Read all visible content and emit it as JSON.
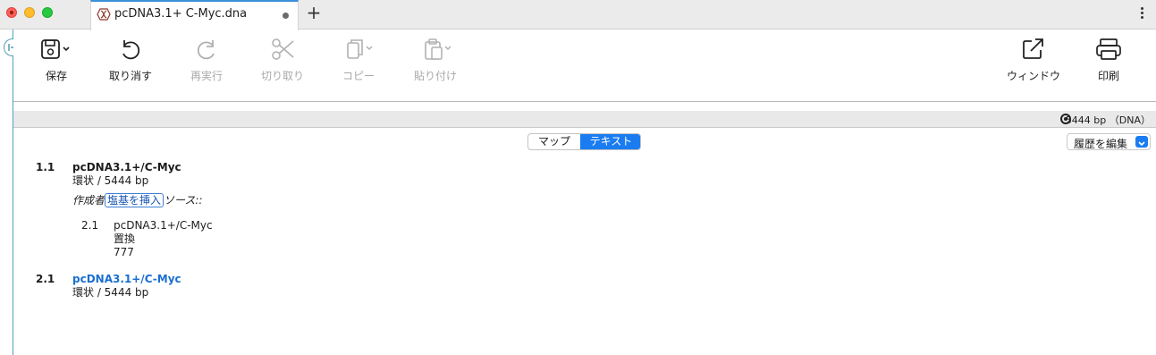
{
  "window": {
    "tab_title": "pcDNA3.1+ C-Myc.dna",
    "new_tab_glyph": "+"
  },
  "toolbar": {
    "save_label": "保存",
    "undo_label": "取り消す",
    "redo_label": "再実行",
    "cut_label": "切り取り",
    "copy_label": "コピー",
    "paste_label": "貼り付け",
    "window_label": "ウィンドウ",
    "print_label": "印刷"
  },
  "status": {
    "size_text": "5444 bp （DNA）"
  },
  "view_switch": {
    "map_label": "マップ",
    "text_label": "テキスト",
    "selected": "テキスト"
  },
  "history": {
    "label": "履歴を編集"
  },
  "document": {
    "entry1": {
      "number": "1.1",
      "title": "pcDNA3.1+/C-Myc",
      "topology": "環状 / 5444 bp",
      "author_label": "作成者",
      "insert_button": "塩基を挿入",
      "source_label": "ソース::",
      "sub": {
        "number": "2.1",
        "title": "pcDNA3.1+/C-Myc",
        "type": "置換",
        "value": "777"
      }
    },
    "entry2": {
      "number": "2.1",
      "title": "pcDNA3.1+/C-Myc",
      "topology": "環状 / 5444 bp"
    }
  },
  "colors": {
    "accent": "#1a7cf0",
    "link": "#1a6fd0",
    "rail": "#4fa3b6"
  },
  "icons": [
    "save-icon",
    "undo-icon",
    "redo-icon",
    "scissors-icon",
    "copy-icon",
    "paste-icon",
    "open-window-icon",
    "printer-icon",
    "sidebar-toggle-icon",
    "dna-file-icon",
    "sequence-circle-icon"
  ]
}
